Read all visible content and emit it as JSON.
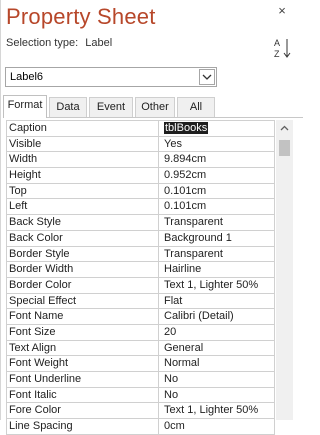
{
  "panel": {
    "title": "Property Sheet",
    "close_glyph": "×",
    "selection_type_label": "Selection type:",
    "selection_type_value": "Label",
    "sort_icon": "sort-a-z-icon"
  },
  "selector": {
    "value": "Label6"
  },
  "tabs": [
    {
      "label": "Format",
      "active": true
    },
    {
      "label": "Data",
      "active": false
    },
    {
      "label": "Event",
      "active": false
    },
    {
      "label": "Other",
      "active": false
    },
    {
      "label": "All",
      "active": false
    }
  ],
  "properties": [
    {
      "name": "Caption",
      "value": "tblBooks",
      "selected": true
    },
    {
      "name": "Visible",
      "value": "Yes"
    },
    {
      "name": "Width",
      "value": "9.894cm"
    },
    {
      "name": "Height",
      "value": "0.952cm"
    },
    {
      "name": "Top",
      "value": "0.101cm"
    },
    {
      "name": "Left",
      "value": "0.101cm"
    },
    {
      "name": "Back Style",
      "value": "Transparent"
    },
    {
      "name": "Back Color",
      "value": "Background 1"
    },
    {
      "name": "Border Style",
      "value": "Transparent"
    },
    {
      "name": "Border Width",
      "value": "Hairline"
    },
    {
      "name": "Border Color",
      "value": "Text 1, Lighter 50%"
    },
    {
      "name": "Special Effect",
      "value": "Flat"
    },
    {
      "name": "Font Name",
      "value": "Calibri (Detail)"
    },
    {
      "name": "Font Size",
      "value": "20"
    },
    {
      "name": "Text Align",
      "value": "General"
    },
    {
      "name": "Font Weight",
      "value": "Normal"
    },
    {
      "name": "Font Underline",
      "value": "No"
    },
    {
      "name": "Font Italic",
      "value": "No"
    },
    {
      "name": "Fore Color",
      "value": "Text 1, Lighter 50%"
    },
    {
      "name": "Line Spacing",
      "value": "0cm"
    }
  ],
  "colors": {
    "title": "#b7472a",
    "selected_bg": "#1f1f1f"
  }
}
